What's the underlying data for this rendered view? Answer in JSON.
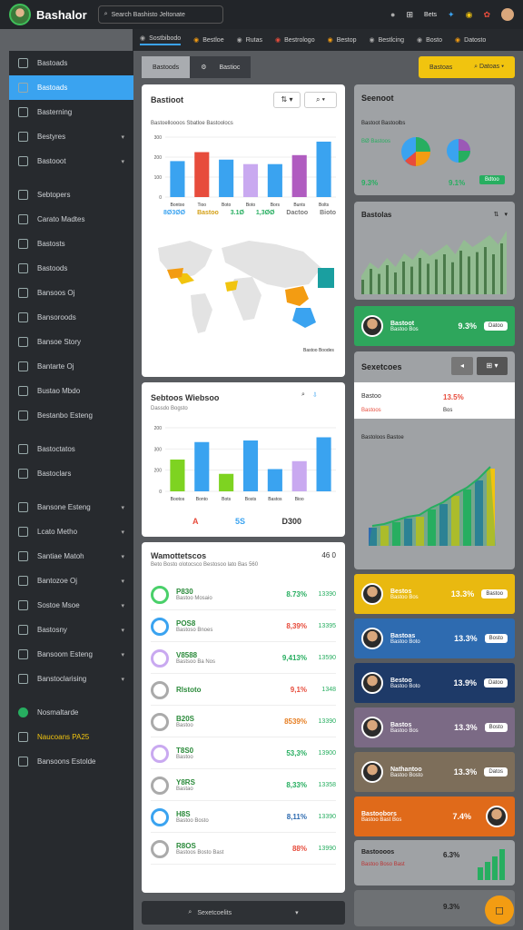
{
  "topbar": {
    "brand": "Bashalor",
    "search_placeholder": "Search Bashisto Jeltonate",
    "icons": [
      "moon-icon",
      "grid-icon",
      "flag-icon",
      "settings-icon",
      "coins-icon",
      "user-icon"
    ],
    "label": "Bets"
  },
  "tabs": [
    {
      "label": "Sostbibodo"
    },
    {
      "label": "Bestloe"
    },
    {
      "label": "Rutas"
    },
    {
      "label": "Bestrologo"
    },
    {
      "label": "Bestop"
    },
    {
      "label": "Bestlcing"
    },
    {
      "label": "Bosto"
    },
    {
      "label": "Datosto"
    }
  ],
  "sidebar": {
    "items": [
      {
        "label": "Bastoads",
        "chevron": false,
        "active": false
      },
      {
        "label": "Bastoads",
        "chevron": false,
        "active": true
      },
      {
        "label": "Basterning",
        "chevron": false,
        "active": false
      },
      {
        "label": "Bestyres",
        "chevron": true,
        "active": false
      },
      {
        "label": "Bastooot",
        "chevron": true,
        "active": false
      },
      {
        "label": "Sebtopers",
        "chevron": false,
        "active": false
      },
      {
        "label": "Carato Madtes",
        "chevron": false,
        "active": false
      },
      {
        "label": "Bastosts",
        "chevron": false,
        "active": false
      },
      {
        "label": "Bastoods",
        "chevron": false,
        "active": false
      },
      {
        "label": "Bansoos Oj",
        "chevron": false,
        "active": false
      },
      {
        "label": "Bansoroods",
        "chevron": false,
        "active": false
      },
      {
        "label": "Bansoe Story",
        "chevron": false,
        "active": false
      },
      {
        "label": "Bantarte Oj",
        "chevron": false,
        "active": false
      },
      {
        "label": "Bustao Mbdo",
        "chevron": false,
        "active": false
      },
      {
        "label": "Bestanbo Esteng",
        "chevron": false,
        "active": false
      },
      {
        "label": "Bastoctatos",
        "chevron": false,
        "active": false
      },
      {
        "label": "Bastoclars",
        "chevron": false,
        "active": false
      },
      {
        "label": "Bansone Esteng",
        "chevron": true,
        "active": false
      },
      {
        "label": "Lcato Metho",
        "chevron": true,
        "active": false
      },
      {
        "label": "Santiae Matoh",
        "chevron": true,
        "active": false
      },
      {
        "label": "Bantozoe Oj",
        "chevron": true,
        "active": false
      },
      {
        "label": "Sostoe Msoe",
        "chevron": true,
        "active": false
      },
      {
        "label": "Bastosny",
        "chevron": true,
        "active": false
      },
      {
        "label": "Bansoom Esteng",
        "chevron": true,
        "active": false
      },
      {
        "label": "Banstoclarising",
        "chevron": true,
        "active": false
      },
      {
        "label": "Nosmaltarde",
        "chevron": false,
        "active": false
      },
      {
        "label": "Naucoans PA25",
        "chevron": false,
        "active": false
      },
      {
        "label": "Bansoons Estolde",
        "chevron": false,
        "active": false
      }
    ]
  },
  "subtabs": [
    "Bastoods",
    "Bastioc"
  ],
  "yellow_button": {
    "left": "Bastoas",
    "right": "Datoas"
  },
  "card1": {
    "title": "Bastioot",
    "subtitle": "Bastoelloooos Sbatloe Bastoolocs",
    "chart_data": {
      "type": "bar",
      "categories": [
        "Bontoo",
        "Tioo",
        "Boto",
        "Boto",
        "Bors",
        "Bunts",
        "Bolts"
      ],
      "values": [
        240,
        300,
        250,
        220,
        220,
        280,
        370
      ],
      "colors": [
        "#3aa3f0",
        "#e74c3c",
        "#3aa3f0",
        "#c9a9f0",
        "#3aa3f0",
        "#b05cc0",
        "#3aa3f0"
      ],
      "yticks": [
        "300",
        "200",
        "100",
        "0"
      ],
      "ylim": [
        0,
        400
      ]
    },
    "stats": [
      {
        "value": "8Ø3ØØ",
        "color": "#3aa3f0"
      },
      {
        "value": "Bastoo",
        "color": "#d4a017"
      },
      {
        "value": "3.1Ø",
        "color": "#27ae60"
      },
      {
        "value": "1,3ØØ",
        "color": "#27ae60"
      },
      {
        "value": "Dactoo",
        "color": "#777"
      },
      {
        "value": "Bioto",
        "color": "#777"
      }
    ],
    "map_legend": "Bastoo Boodes"
  },
  "card2": {
    "title": "Sebtoos Wiebsoo",
    "subtitle": "Dassdo Bogsto",
    "chart_data": {
      "type": "bar",
      "categories": [
        "Bootos",
        "Bonto",
        "Bots",
        "Bosts",
        "Bastos",
        "Bioo"
      ],
      "values": [
        200,
        310,
        110,
        320,
        140,
        190,
        340
      ],
      "colors": [
        "#7ed321",
        "#3aa3f0",
        "#7ed321",
        "#3aa3f0",
        "#3aa3f0",
        "#c9a9f0",
        "#3aa3f0"
      ],
      "yticks": [
        "200",
        "300",
        "200",
        "0"
      ],
      "ylim": [
        0,
        400
      ]
    },
    "stats": [
      {
        "value": "A",
        "color": "#e74c3c"
      },
      {
        "value": "5S",
        "color": "#3aa3f0"
      },
      {
        "value": "D300",
        "color": "#333"
      }
    ]
  },
  "list": {
    "title": "Wamottetscos",
    "count": "46 0",
    "subtitle": "Beto Bosto olotocsco Bestosoo lato Bas 560",
    "rows": [
      {
        "name": "P830",
        "sub": "Bastoo Mosaio",
        "v1": "8.73%",
        "v2": "13390",
        "c": "#4ad06a"
      },
      {
        "name": "POS8",
        "sub": "Bastoso Bnoes",
        "v1": "8,39%",
        "v2": "13395",
        "c": "#3aa3f0"
      },
      {
        "name": "V8588",
        "sub": "Bastsoo Ba Nos",
        "v1": "9,413%",
        "v2": "13590",
        "c": "#c9a9f0"
      },
      {
        "name": "Rlstoto",
        "sub": "",
        "v1": "9,1%",
        "v2": "1348",
        "c": "#aaa"
      },
      {
        "name": "B20S",
        "sub": "Bastoo",
        "v1": "8539%",
        "v2": "13390",
        "c": "#aaa"
      },
      {
        "name": "T8S0",
        "sub": "Bastoo",
        "v1": "53,3%",
        "v2": "13900",
        "c": "#c9a9f0"
      },
      {
        "name": "Y8RS",
        "sub": "Bastao",
        "v1": "8,33%",
        "v2": "13358",
        "c": "#aaa"
      },
      {
        "name": "H8S",
        "sub": "Bastoo Bosto",
        "v1": "8,11%",
        "v2": "13390",
        "c": "#3aa3f0"
      },
      {
        "name": "R8OS",
        "sub": "Bastoos Bosto Bast",
        "v1": "88%",
        "v2": "13990",
        "c": "#aaa"
      }
    ]
  },
  "right": {
    "summary": {
      "title": "Seenoot",
      "line1": "Bastoot Bastoolbs",
      "line2": "BØ Bastoos",
      "v1": "9.3%",
      "v2": "9.1%",
      "btn": "Bdtoo"
    },
    "area": {
      "title": "Bastolas"
    },
    "person1": {
      "name": "Bastoot",
      "sub": "Bastoo Bos",
      "value": "9.3%",
      "btn": "Datoo"
    },
    "sectors": {
      "title": "Sexetcoes",
      "a": "Bastoo",
      "b": "Bastoos",
      "v1": "13.5%",
      "v2": "Bos"
    },
    "bars2": {
      "title": "Bastoloos Bastoe"
    },
    "persons": [
      {
        "name": "Bestos",
        "sub": "Bastoo Bos",
        "value": "13.3%",
        "btn": "Bastoo",
        "bg": "#e9b910"
      },
      {
        "name": "Bastoas",
        "sub": "Bastoo Boto",
        "value": "13.3%",
        "btn": "Bosto",
        "bg": "#2e6bb0"
      },
      {
        "name": "Bestoo",
        "sub": "Bastoo Boto",
        "value": "13.9%",
        "btn": "Datoo",
        "bg": "#1e3a68"
      },
      {
        "name": "Bastos",
        "sub": "Bastoo Bos",
        "value": "13.3%",
        "btn": "Bosto",
        "bg": "#7b6a85"
      },
      {
        "name": "Nathantoo",
        "sub": "Bastoo Bosto",
        "value": "13.3%",
        "btn": "Datos",
        "bg": "#7d6e5a"
      },
      {
        "name": "Bastoobors",
        "sub": "Bastoo Bast Bos",
        "value": "7.4%",
        "btn": "",
        "bg": "#e06a1a"
      }
    ],
    "last": {
      "title": "Bastoooos",
      "sub": "Bastoo Boso Bast",
      "value": "6.3%"
    },
    "bottom": {
      "value": "9.3%"
    }
  },
  "bottombar": {
    "label": "Sexetcoelits"
  }
}
